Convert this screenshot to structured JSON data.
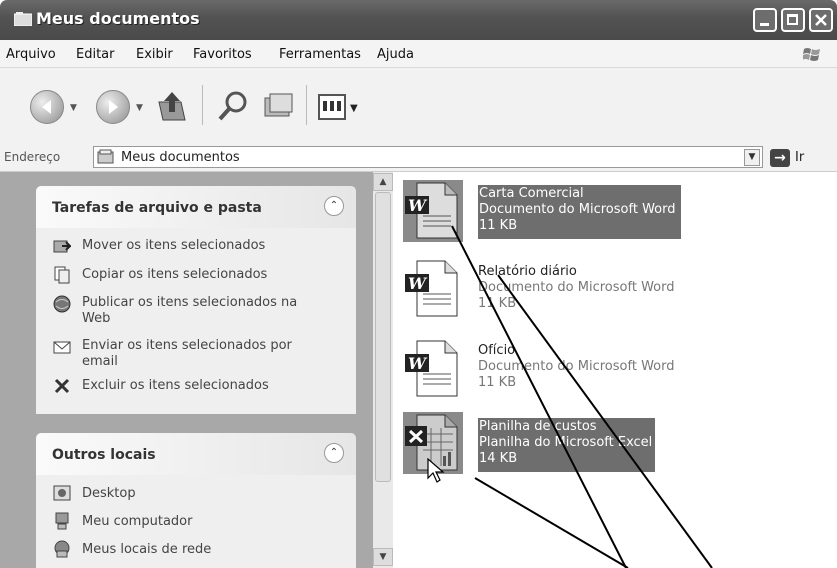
{
  "window": {
    "title": "Meus documentos"
  },
  "menu": {
    "items": [
      "Arquivo",
      "Editar",
      "Exibir",
      "Favoritos",
      "Ferramentas",
      "Ajuda"
    ]
  },
  "address": {
    "label": "Endereço",
    "value": "Meus documentos",
    "go_label": "Ir"
  },
  "tasks_panel": {
    "title": "Tarefas de arquivo e pasta",
    "items": [
      {
        "label": "Mover os itens selecionados",
        "icon": "move-icon"
      },
      {
        "label": "Copiar os itens selecionados",
        "icon": "copy-icon"
      },
      {
        "label": "Publicar os itens selecionados na Web",
        "icon": "publish-icon"
      },
      {
        "label": "Enviar os itens selecionados por email",
        "icon": "email-icon"
      },
      {
        "label": "Excluir os itens selecionados",
        "icon": "delete-icon"
      }
    ]
  },
  "places_panel": {
    "title": "Outros locais",
    "items": [
      {
        "label": "Desktop",
        "icon": "desktop-icon"
      },
      {
        "label": "Meu computador",
        "icon": "computer-icon"
      },
      {
        "label": "Meus locais de rede",
        "icon": "network-icon"
      }
    ]
  },
  "files": [
    {
      "name": "Carta Comercial",
      "type": "Documento do Microsoft Word",
      "size": "11 KB",
      "icon": "word-document-icon",
      "selected": true
    },
    {
      "name": "Relatório diário",
      "type": "Documento do Microsoft Word",
      "size": "11 KB",
      "icon": "word-document-icon",
      "selected": false
    },
    {
      "name": "Ofício",
      "type": "Documento do Microsoft Word",
      "size": "11 KB",
      "icon": "word-document-icon",
      "selected": false
    },
    {
      "name": "Planilha de custos",
      "type": "Planilha do Microsoft Excel",
      "size": "14 KB",
      "icon": "excel-spreadsheet-icon",
      "selected": true
    }
  ]
}
